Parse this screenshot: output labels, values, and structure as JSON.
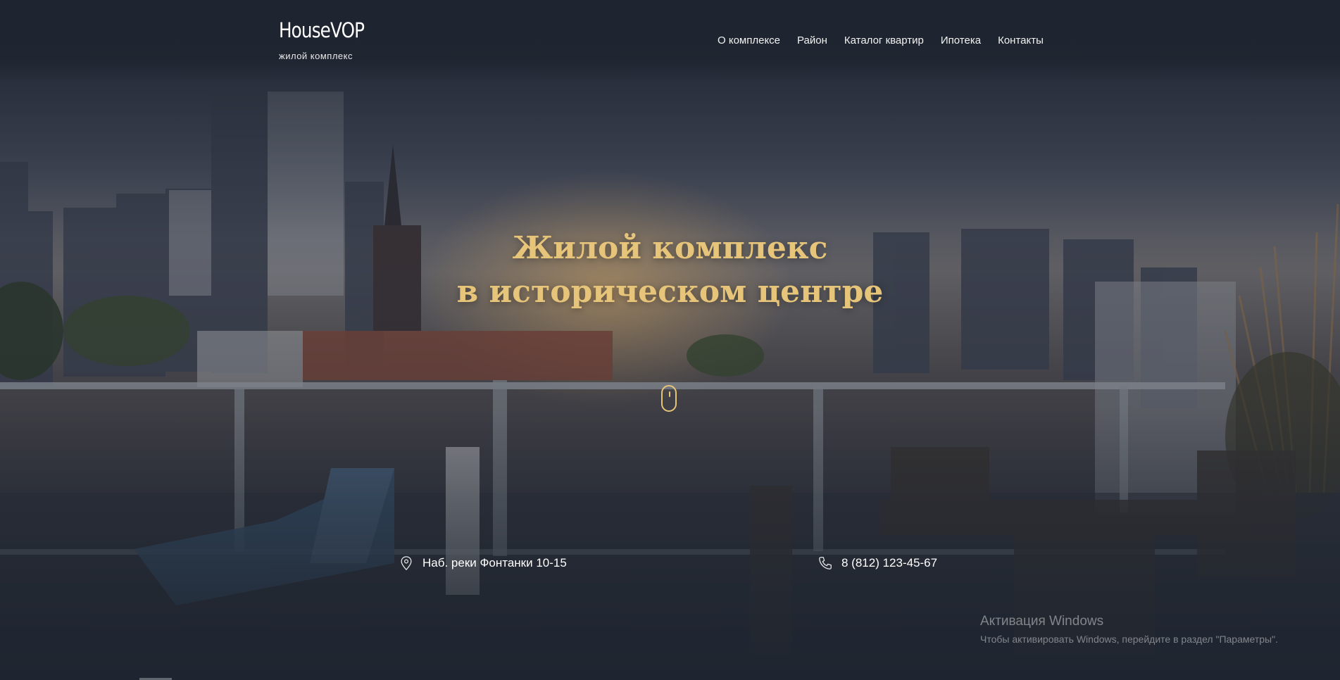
{
  "header": {
    "logo_title": "HouseVOP",
    "logo_subtitle": "жилой комплекс",
    "nav": [
      {
        "label": "О комплексе"
      },
      {
        "label": "Район"
      },
      {
        "label": "Каталог квартир"
      },
      {
        "label": "Ипотека"
      },
      {
        "label": "Контакты"
      }
    ]
  },
  "hero": {
    "headline_line1": "Жилой комплекс",
    "headline_line2": "в историческом центре",
    "address": "Наб. реки Фонтанки 10-15",
    "phone": "8 (812) 123-45-67"
  },
  "os_watermark": {
    "title": "Активация Windows",
    "subtitle": "Чтобы активировать Windows, перейдите в раздел \"Параметры\"."
  },
  "colors": {
    "accent": "#e6c57a",
    "background": "#1f2530",
    "nav_text": "#f2f2f2"
  },
  "icons": {
    "address": "map-pin-icon",
    "phone": "phone-icon",
    "scroll": "mouse-scroll-icon"
  }
}
